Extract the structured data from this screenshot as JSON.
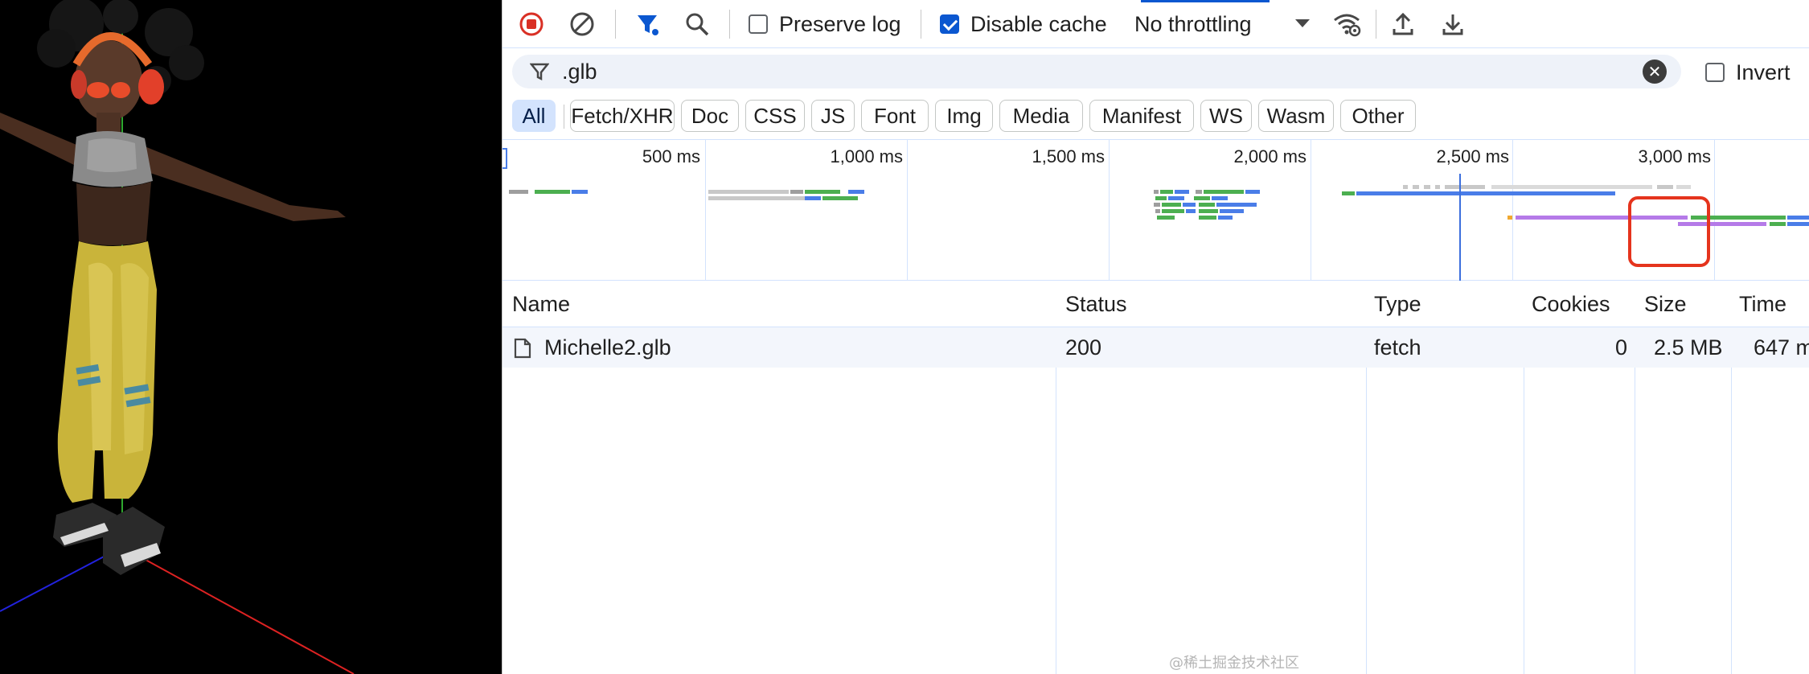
{
  "toolbar": {
    "preserve_log_label": "Preserve log",
    "preserve_log_checked": false,
    "disable_cache_label": "Disable cache",
    "disable_cache_checked": true,
    "throttling_value": "No throttling"
  },
  "filter": {
    "value": ".glb",
    "invert_label": "Invert",
    "invert_checked": false
  },
  "type_filters": [
    "All",
    "Fetch/XHR",
    "Doc",
    "CSS",
    "JS",
    "Font",
    "Img",
    "Media",
    "Manifest",
    "WS",
    "Wasm",
    "Other"
  ],
  "active_type_filter": "All",
  "overview": {
    "ticks": [
      "500 ms",
      "1,000 ms",
      "1,500 ms",
      "2,000 ms",
      "2,500 ms",
      "3,000 ms"
    ]
  },
  "table": {
    "columns": [
      "Name",
      "Status",
      "Type",
      "Cookies",
      "Size",
      "Time"
    ],
    "rows": [
      {
        "name": "Michelle2.glb",
        "status": "200",
        "type": "fetch",
        "cookies": "0",
        "size": "2.5 MB",
        "time": "647 m"
      }
    ]
  },
  "colors": {
    "accent": "#0b57d0",
    "highlight_box": "#e5341d",
    "record_stop": "#d93025",
    "bar_blue": "#4a7de8",
    "bar_green": "#4caf50",
    "bar_gray": "#c8c8c8",
    "bar_purple": "#b57ae8"
  },
  "watermark": "@稀土掘金技术社区"
}
